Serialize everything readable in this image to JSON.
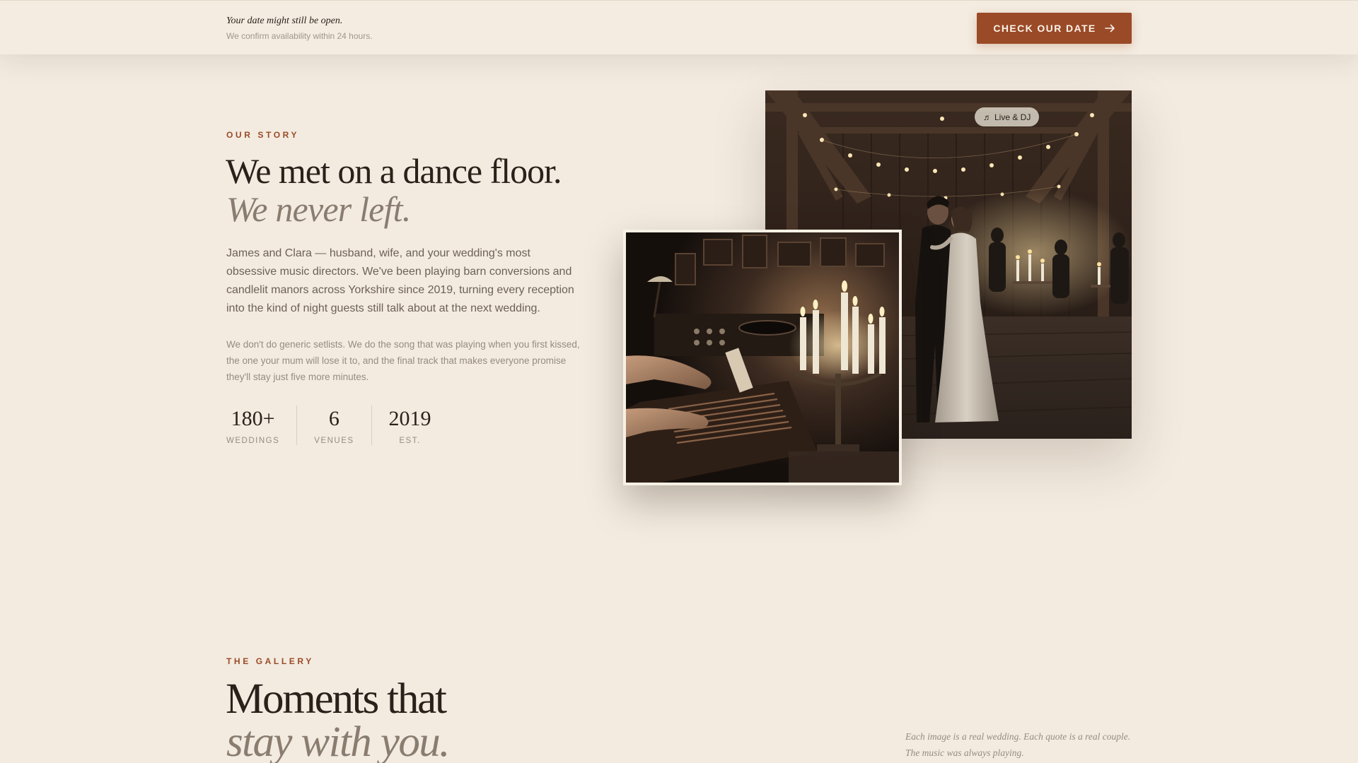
{
  "banner": {
    "title": "Your date might still be open.",
    "subtitle": "We confirm availability within 24 hours.",
    "cta_label": "CHECK OUR DATE",
    "cta_icon": "arrow-right-icon"
  },
  "story": {
    "eyebrow": "OUR STORY",
    "headline_line1": "We met on a dance floor.",
    "headline_line2": "We never left.",
    "paragraph1": "James and Clara — husband, wife, and your wedding's most obsessive music directors. We've been playing barn conversions and candlelit manors across Yorkshire since 2019, turning every reception into the kind of night guests still talk about at the next wedding.",
    "paragraph2": "We don't do generic setlists. We do the song that was playing when you first kissed, the one your mum will lose it to, and the final track that makes everyone promise they'll stay just five more minutes.",
    "stats": [
      {
        "value": "180+",
        "label": "WEDDINGS"
      },
      {
        "value": "6",
        "label": "VENUES"
      },
      {
        "value": "2019",
        "label": "EST."
      }
    ],
    "photo_badge": {
      "icon": "music-note-icon",
      "glyph": "♬",
      "label": "Live & DJ"
    }
  },
  "gallery": {
    "eyebrow": "THE GALLERY",
    "headline_line1": "Moments that",
    "headline_line2": "stay with you.",
    "note": "Each image is a real wedding. Each quote is a real couple. The music was always playing."
  },
  "colors": {
    "background": "#f3ebe0",
    "accent": "#9a4a27",
    "heading": "#2a211a",
    "muted_heading": "#8a7d70",
    "body_text": "#6d6157"
  }
}
